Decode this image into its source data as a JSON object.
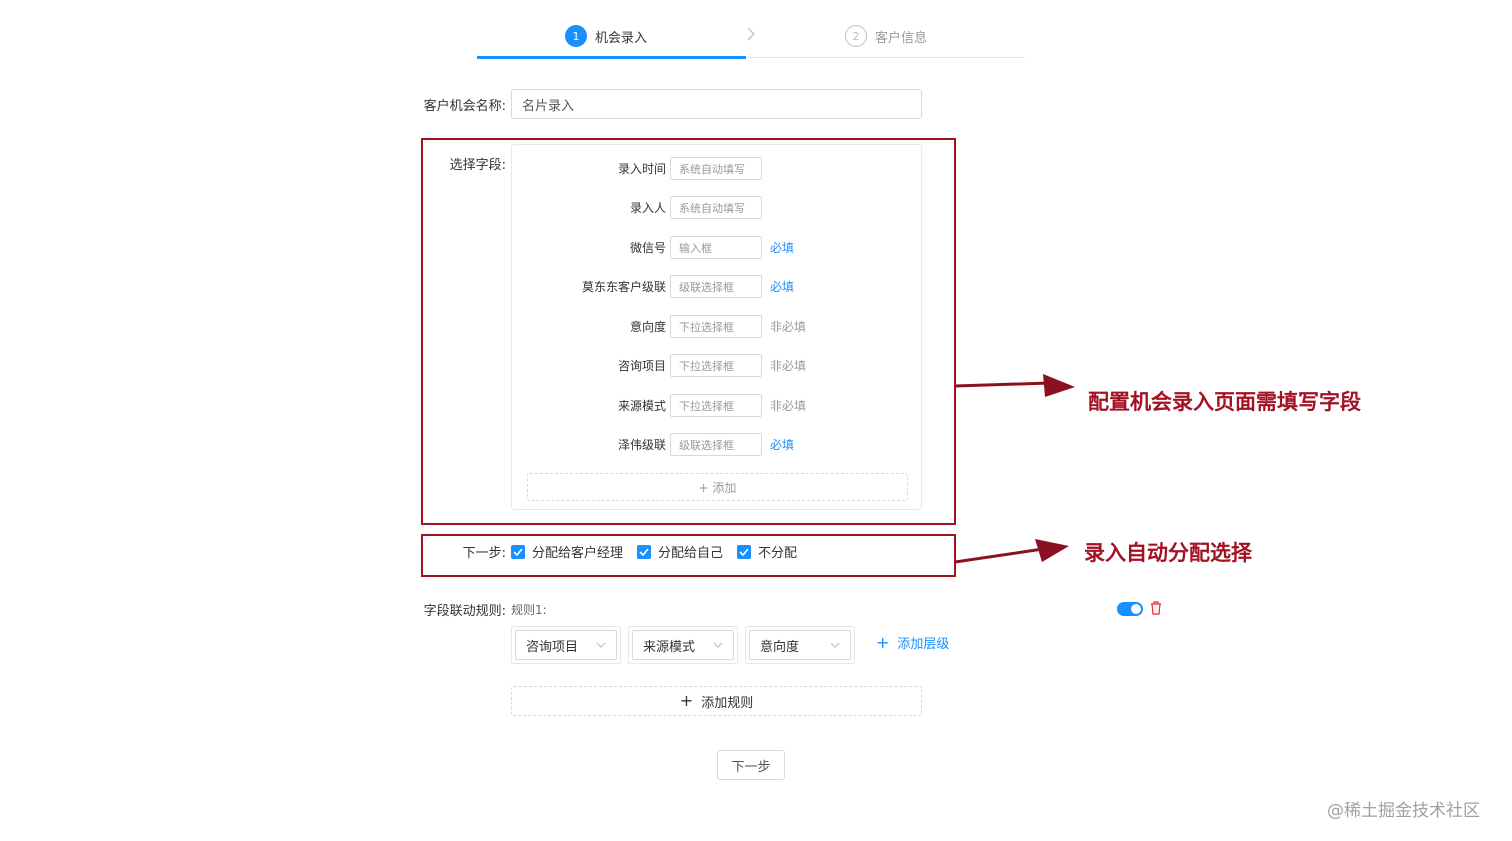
{
  "steps": [
    {
      "num": "1",
      "label": "机会录入"
    },
    {
      "num": "2",
      "label": "客户信息"
    }
  ],
  "form": {
    "name_label": "客户机会名称:",
    "name_value": "名片录入",
    "fields_label": "选择字段:",
    "fields": [
      {
        "label": "录入时间",
        "placeholder": "系统自动填写",
        "required": ""
      },
      {
        "label": "录入人",
        "placeholder": "系统自动填写",
        "required": ""
      },
      {
        "label": "微信号",
        "placeholder": "输入框",
        "required": "必填"
      },
      {
        "label": "莫东东客户级联",
        "placeholder": "级联选择框",
        "required": "必填"
      },
      {
        "label": "意向度",
        "placeholder": "下拉选择框",
        "required": "非必填"
      },
      {
        "label": "咨询项目",
        "placeholder": "下拉选择框",
        "required": "非必填"
      },
      {
        "label": "来源模式",
        "placeholder": "下拉选择框",
        "required": "非必填"
      },
      {
        "label": "泽伟级联",
        "placeholder": "级联选择框",
        "required": "必填"
      }
    ],
    "add_field": "+ 添加",
    "next_label": "下一步:",
    "next_options": [
      "分配给客户经理",
      "分配给自己",
      "不分配"
    ],
    "rule_label": "字段联动规则:",
    "rule_name": "规则1:",
    "rule_selects": [
      "咨询项目",
      "来源模式",
      "意向度"
    ],
    "add_level": "添加层级",
    "add_rule": "添加规则",
    "next_button": "下一步"
  },
  "annotations": {
    "fields_note": "配置机会录入页面需填写字段",
    "next_note": "录入自动分配选择"
  },
  "watermark": "@稀土掘金技术社区",
  "colors": {
    "primary": "#1890ff",
    "annotation": "#a31224",
    "required": "#1890ff",
    "optional": "#999999",
    "delete": "#f5222d"
  },
  "icons": [
    "check-icon",
    "chevron-right-icon",
    "chevron-down-icon",
    "plus-icon",
    "toggle-icon",
    "trash-icon",
    "arrow-right-icon"
  ]
}
